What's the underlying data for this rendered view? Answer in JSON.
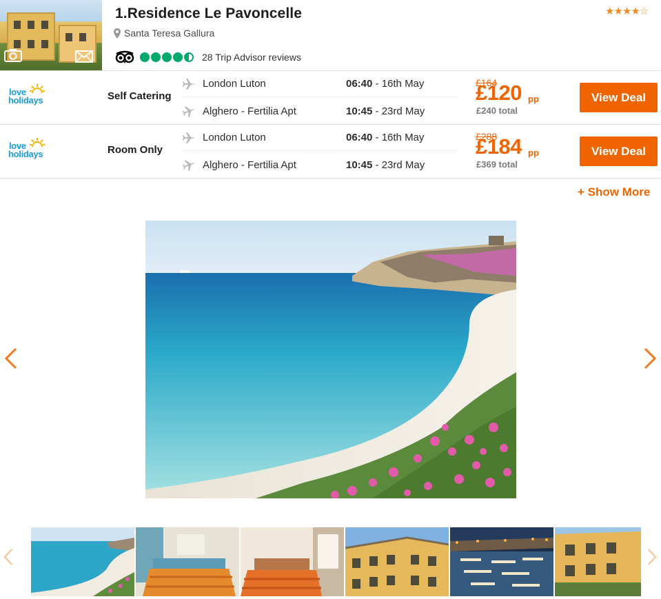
{
  "hotel": {
    "title": "1.Residence Le Pavoncelle",
    "location": "Santa Teresa Gallura",
    "stars": "★★★★☆",
    "tripadvisor_reviews": "28 Trip Advisor reviews",
    "tripadvisor_rating": 4.5
  },
  "provider": {
    "logo_line1": "love",
    "logo_line2": "holidays"
  },
  "deals": [
    {
      "board": "Self Catering",
      "outbound_airport": "London Luton",
      "outbound_time": "06:40",
      "outbound_date": " - 16th May",
      "return_airport": "Alghero - Fertilia Apt",
      "return_time": "10:45",
      "return_date": " - 23rd May",
      "old_price": "£164",
      "price": "£120",
      "pp": "pp",
      "total": "£240 total",
      "button": "View Deal"
    },
    {
      "board": "Room Only",
      "outbound_airport": "London Luton",
      "outbound_time": "06:40",
      "outbound_date": " - 16th May",
      "return_airport": "Alghero - Fertilia Apt",
      "return_time": "10:45",
      "return_date": " - 23rd May",
      "old_price": "£288",
      "price": "£184",
      "pp": "pp",
      "total": "£369 total",
      "button": "View Deal"
    }
  ],
  "show_more": "+ Show More",
  "colors": {
    "accent": "#f06400",
    "tripadvisor": "#00aa6c",
    "provider_blue": "#1b9bd7"
  },
  "icons": [
    "camera-icon",
    "mail-icon",
    "map-pin-icon",
    "tripadvisor-owl-icon",
    "plane-icon",
    "chevron-left-icon",
    "chevron-right-icon"
  ]
}
